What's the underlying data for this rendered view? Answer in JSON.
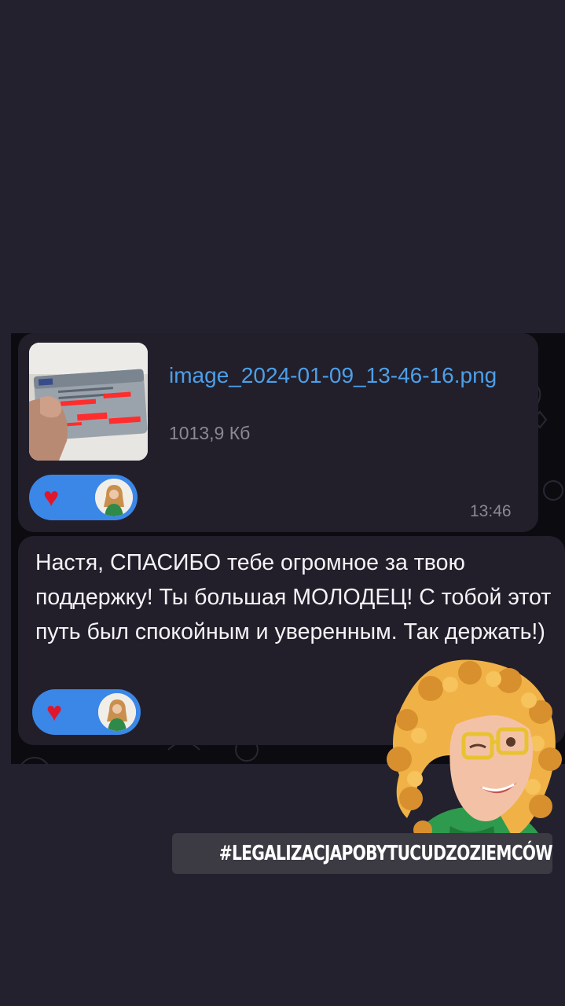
{
  "file_message": {
    "file_name": "image_2024-01-09_13-46-16.png",
    "file_size": "1013,9 Кб",
    "time": "13:46",
    "reaction_emoji": "♥"
  },
  "text_message": {
    "text": "Настя, СПАСИБО тебе огромное за твою поддержку! Ты большая МОЛОДЕЦ! С тобой этот путь был спокойным и уверенным. Так держать!)",
    "reaction_emoji": "♥"
  },
  "hashtag": "#LEGALIZACJAPOBYTUCUDZOZIEMCÓW",
  "colors": {
    "background": "#23212d",
    "bubble": "#221f2b",
    "link": "#4d9fe8",
    "reaction": "#3a87e8",
    "heart": "#e0162b"
  }
}
